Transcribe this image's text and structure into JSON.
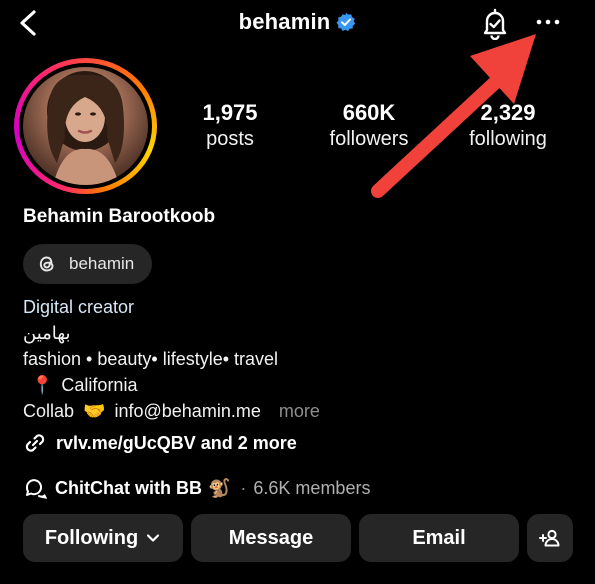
{
  "header": {
    "username": "behamin",
    "verified": true,
    "icons": [
      "back-chevron-icon",
      "verified-badge-icon",
      "bell-check-icon",
      "more-dots-icon"
    ]
  },
  "profile": {
    "display_name": "Behamin Barootkoob",
    "threads_handle": "behamin"
  },
  "stats": [
    {
      "value": "1,975",
      "label": "posts"
    },
    {
      "value": "660K",
      "label": "followers"
    },
    {
      "value": "2,329",
      "label": "following"
    }
  ],
  "bio": {
    "category": "Digital creator",
    "persian_name": "بهامین",
    "tags": "fashion • beauty• lifestyle• travel",
    "location_emoji": "📍",
    "location": "California",
    "collab_prefix": "Collab",
    "collab_emoji": "🤝",
    "email": "info@behamin.me",
    "more": "more",
    "link": "rvlv.me/gUcQBV and 2 more",
    "channel_name": "ChitChat with BB",
    "channel_emoji": "🐒",
    "channel_separator": "·",
    "channel_members": "6.6K members"
  },
  "actions": {
    "following": "Following",
    "message": "Message",
    "email": "Email"
  },
  "colors": {
    "background": "#000000",
    "button_bg": "#262626",
    "verified_blue": "#3897f0",
    "category_text": "#d6e6f5",
    "muted_text": "#8e8e8e",
    "annotation_arrow": "#f0413a"
  }
}
